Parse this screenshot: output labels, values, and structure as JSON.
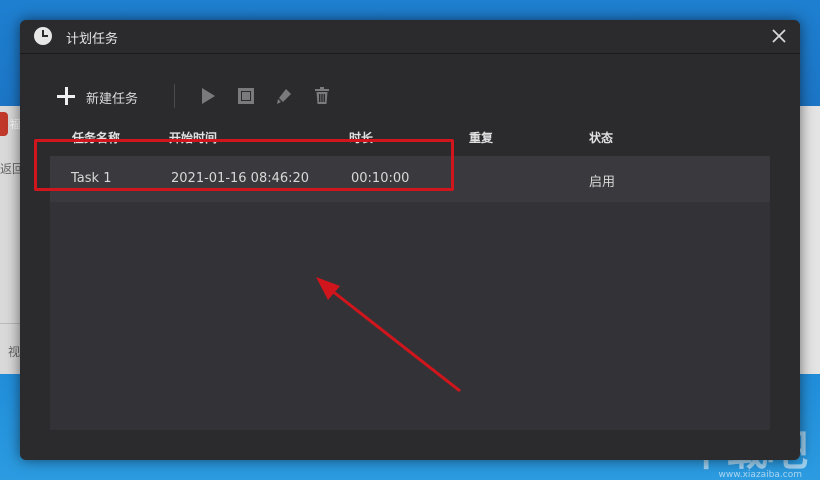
{
  "background": {
    "left_panel_texts": [
      "福",
      "返回",
      "视"
    ],
    "watermark": "下载吧",
    "watermark_url": "www.xiazaiba.com"
  },
  "dialog": {
    "title": "计划任务",
    "icon": "clock-icon",
    "close_icon": "close-icon"
  },
  "toolbar": {
    "new_task_label": "新建任务",
    "icons": [
      "plus-icon",
      "play-icon",
      "stop-icon",
      "edit-icon",
      "trash-icon"
    ]
  },
  "table": {
    "headers": [
      "任务名称",
      "开始时间",
      "时长",
      "重复",
      "状态"
    ],
    "rows": [
      {
        "name": "Task 1",
        "start_time": "2021-01-16 08:46:20",
        "duration": "00:10:00",
        "repeat": "",
        "status": "启用"
      }
    ]
  },
  "colors": {
    "dialog_bg": "#2b2a2d",
    "table_bg": "#333236",
    "row_bg": "#3a393d",
    "annotation_red": "#d0161c"
  }
}
